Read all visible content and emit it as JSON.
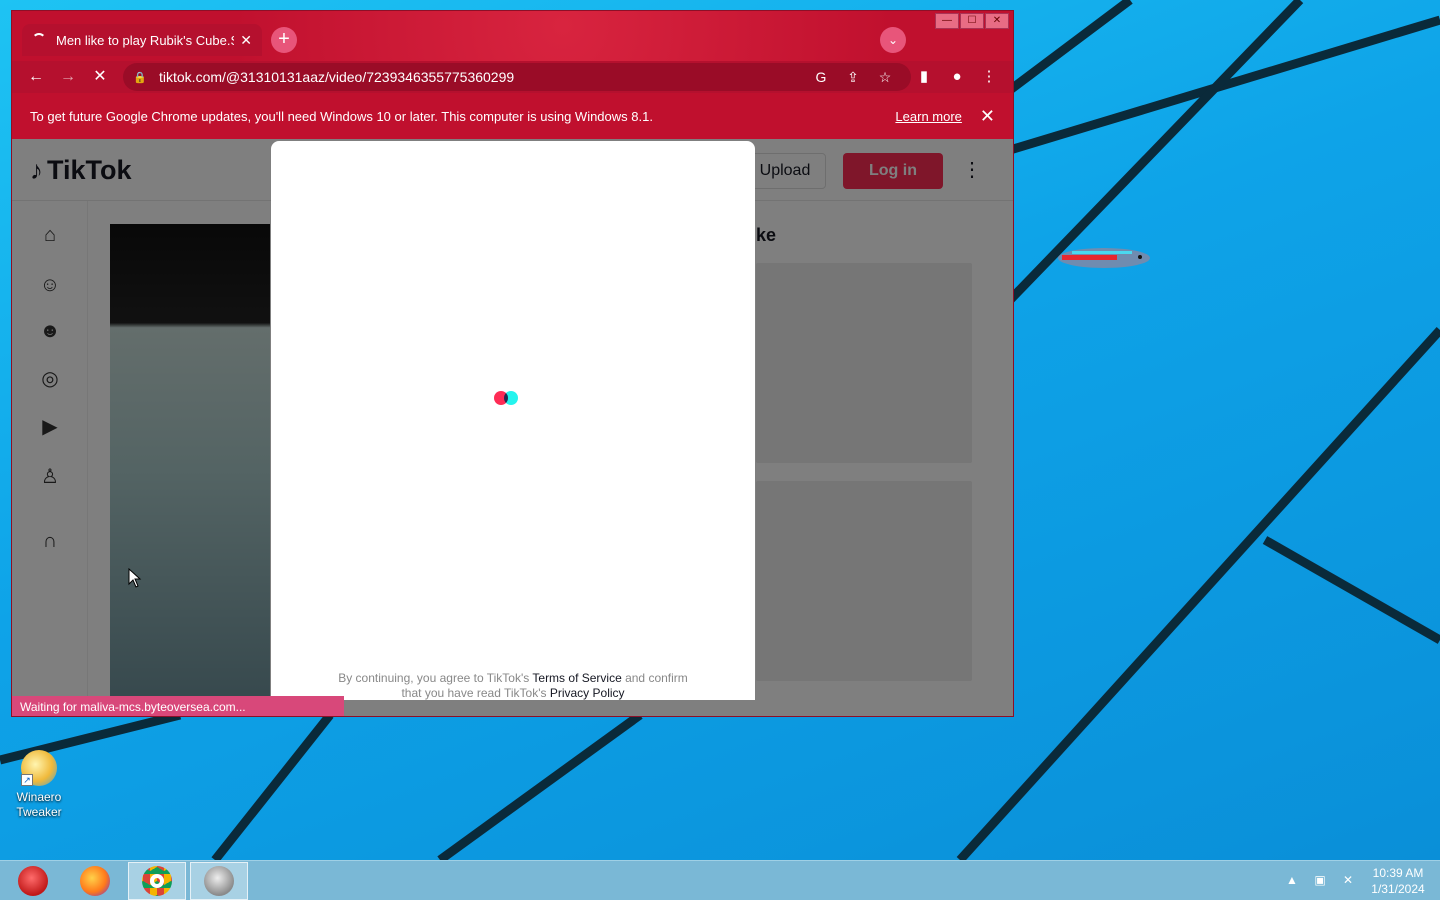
{
  "desktop": {
    "icon_label_1": "Winaero",
    "icon_label_2": "Tweaker"
  },
  "window": {
    "controls": {
      "minimize": "—",
      "maximize": "☐",
      "close": "✕"
    }
  },
  "tab": {
    "title": "Men like to play Rubik's Cube.So",
    "close": "✕",
    "new_tab": "+",
    "tab_search": "⌄"
  },
  "toolbar": {
    "back": "←",
    "forward": "→",
    "reload": "✕",
    "url": "tiktok.com/@31310131aaz/video/7239346355775360299",
    "lock": "🔒",
    "google": "G",
    "share": "⇪",
    "star": "☆",
    "sidepanel": "▮",
    "profile": "●",
    "menu": "⋮"
  },
  "infobar": {
    "message": "To get future Google Chrome updates, you'll need Windows 10 or later. This computer is using Windows 8.1.",
    "learn_more": "Learn more",
    "close": "✕"
  },
  "tiktok": {
    "logo": "TikTok",
    "upload": "Upload",
    "login": "Log in",
    "more": "⋮",
    "related_title": "ke"
  },
  "modal": {
    "terms_prefix": "By continuing, you agree to TikTok's ",
    "terms_link": "Terms of Service",
    "terms_mid": " and confirm that you have read TikTok's ",
    "privacy_link": "Privacy Policy"
  },
  "status": "Waiting for maliva-mcs.byteoversea.com...",
  "taskbar": {
    "time": "10:39 AM",
    "date": "1/31/2024",
    "tray_up": "▲"
  },
  "colors": {
    "chrome_theme": "#c0102e",
    "tiktok_red": "#fe2c55",
    "tiktok_cyan": "#25f4ee",
    "desktop_blue": "#12a6e6"
  }
}
